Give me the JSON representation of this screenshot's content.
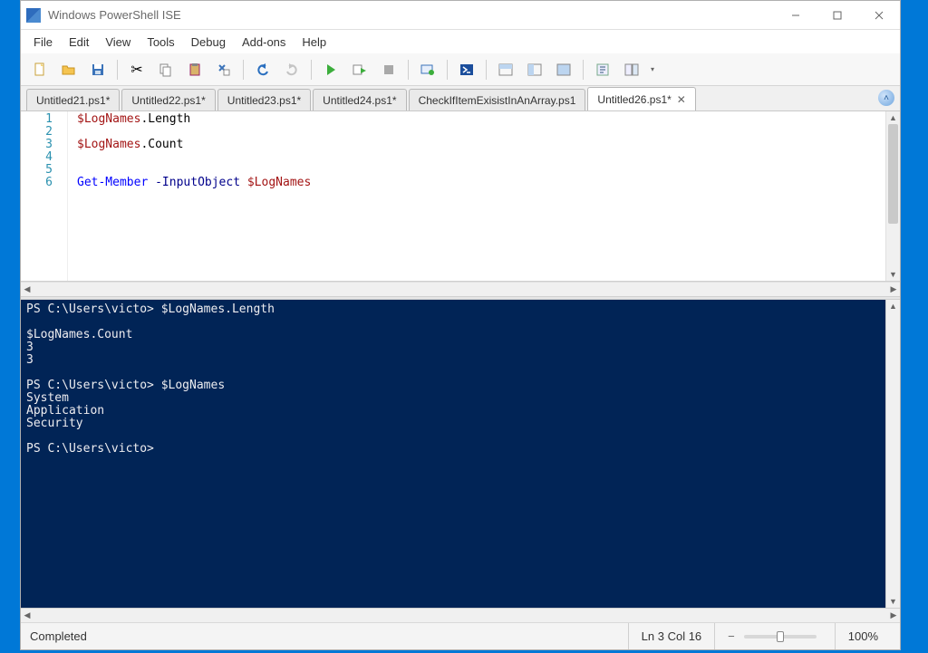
{
  "window": {
    "title": "Windows PowerShell ISE"
  },
  "menus": [
    "File",
    "Edit",
    "View",
    "Tools",
    "Debug",
    "Add-ons",
    "Help"
  ],
  "tabs": [
    {
      "label": "Untitled21.ps1*",
      "active": false
    },
    {
      "label": "Untitled22.ps1*",
      "active": false
    },
    {
      "label": "Untitled23.ps1*",
      "active": false
    },
    {
      "label": "Untitled24.ps1*",
      "active": false
    },
    {
      "label": "CheckIfItemExisistInAnArray.ps1",
      "active": false
    },
    {
      "label": "Untitled26.ps1*",
      "active": true
    }
  ],
  "editor": {
    "line_numbers": [
      "1",
      "2",
      "3",
      "4",
      "5",
      "6"
    ],
    "lines": [
      [
        {
          "t": "$LogNames",
          "c": "tok-var"
        },
        {
          "t": ".Length",
          "c": "tok-mem"
        }
      ],
      [],
      [
        {
          "t": "$LogNames",
          "c": "tok-var"
        },
        {
          "t": ".Count",
          "c": "tok-mem"
        }
      ],
      [],
      [],
      [
        {
          "t": "Get-Member",
          "c": "tok-cmd"
        },
        {
          "t": " ",
          "c": ""
        },
        {
          "t": "-InputObject",
          "c": "tok-param"
        },
        {
          "t": " ",
          "c": ""
        },
        {
          "t": "$LogNames",
          "c": "tok-var"
        }
      ]
    ]
  },
  "console_text": "PS C:\\Users\\victo> $LogNames.Length\n\n$LogNames.Count\n3\n3\n\nPS C:\\Users\\victo> $LogNames\nSystem\nApplication\nSecurity\n\nPS C:\\Users\\victo> ",
  "status": {
    "left": "Completed",
    "position": "Ln 3  Col 16",
    "zoom": "100%"
  }
}
